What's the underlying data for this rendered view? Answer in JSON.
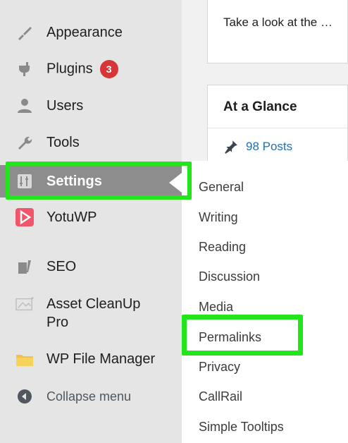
{
  "sidebar": {
    "items": [
      {
        "label": "Appearance",
        "icon": "paint-brush-icon"
      },
      {
        "label": "Plugins",
        "icon": "plugin-icon",
        "badge": "3"
      },
      {
        "label": "Users",
        "icon": "users-icon"
      },
      {
        "label": "Tools",
        "icon": "wrench-icon"
      },
      {
        "label": "Settings",
        "icon": "settings-sliders-icon",
        "active": true
      },
      {
        "label": "YotuWP",
        "icon": "yotuwp-play-icon"
      },
      {
        "label": "SEO",
        "icon": "seo-icon"
      },
      {
        "label": "Asset CleanUp",
        "label2": "Pro",
        "icon": "asset-cleanup-icon"
      },
      {
        "label": "WP File Manager",
        "icon": "folder-icon"
      },
      {
        "label": "Collapse menu",
        "icon": "collapse-icon"
      }
    ]
  },
  "submenu": {
    "items": [
      "General",
      "Writing",
      "Reading",
      "Discussion",
      "Media",
      "Permalinks",
      "Privacy",
      "CallRail",
      "Simple Tooltips"
    ]
  },
  "main": {
    "top_card_text": "Take a look at the …",
    "glance_title": "At a Glance",
    "posts_link": "98 Posts"
  },
  "colors": {
    "highlight": "#22e51b",
    "link": "#2271b1",
    "badge": "#d63638"
  }
}
